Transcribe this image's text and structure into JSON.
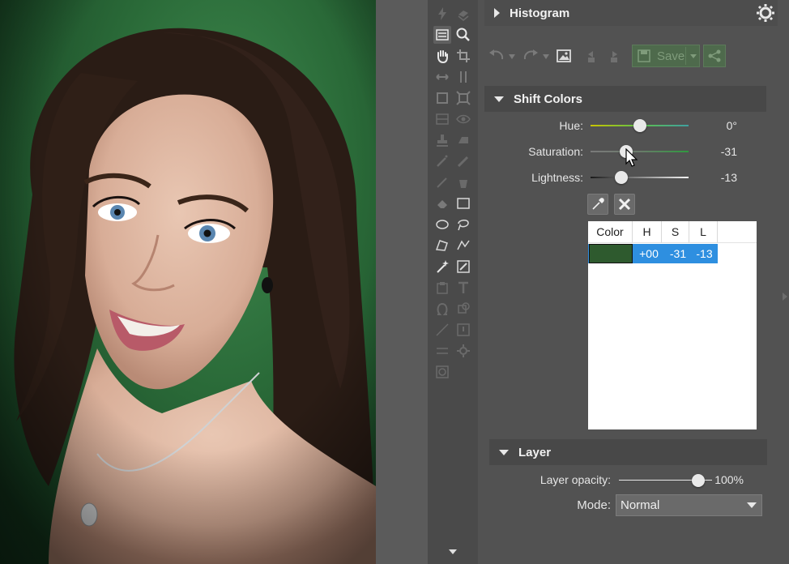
{
  "histogram": {
    "title": "Histogram"
  },
  "toolbar": {
    "save_label": "Save"
  },
  "shift_colors": {
    "title": "Shift Colors",
    "hue": {
      "label": "Hue:",
      "value": "0°",
      "level": 0.5
    },
    "saturation": {
      "label": "Saturation:",
      "value": "-31",
      "level": 0.36
    },
    "lightness": {
      "label": "Lightness:",
      "value": "-13",
      "level": 0.31
    },
    "table": {
      "headers": [
        "Color",
        "H",
        "S",
        "L"
      ],
      "rows": [
        {
          "color": "#2e5a2e",
          "h": "+00",
          "s": "-31",
          "l": "-13"
        }
      ]
    }
  },
  "layer": {
    "title": "Layer",
    "opacity": {
      "label": "Layer opacity:",
      "value": "100%",
      "level": 0.85
    },
    "mode": {
      "label": "Mode:",
      "value": "Normal"
    }
  },
  "colors": {
    "panel": "#525252",
    "header": "#484848",
    "toolbar": "#4a4a4a",
    "selection": "#2e8fe0",
    "save": "#4e6a4c"
  },
  "icons": [
    "settings-icon",
    "undo-icon",
    "redo-icon",
    "image-icon",
    "flip-left-icon",
    "flip-right-icon",
    "save-icon",
    "share-icon",
    "eyedropper-icon",
    "close-icon"
  ]
}
